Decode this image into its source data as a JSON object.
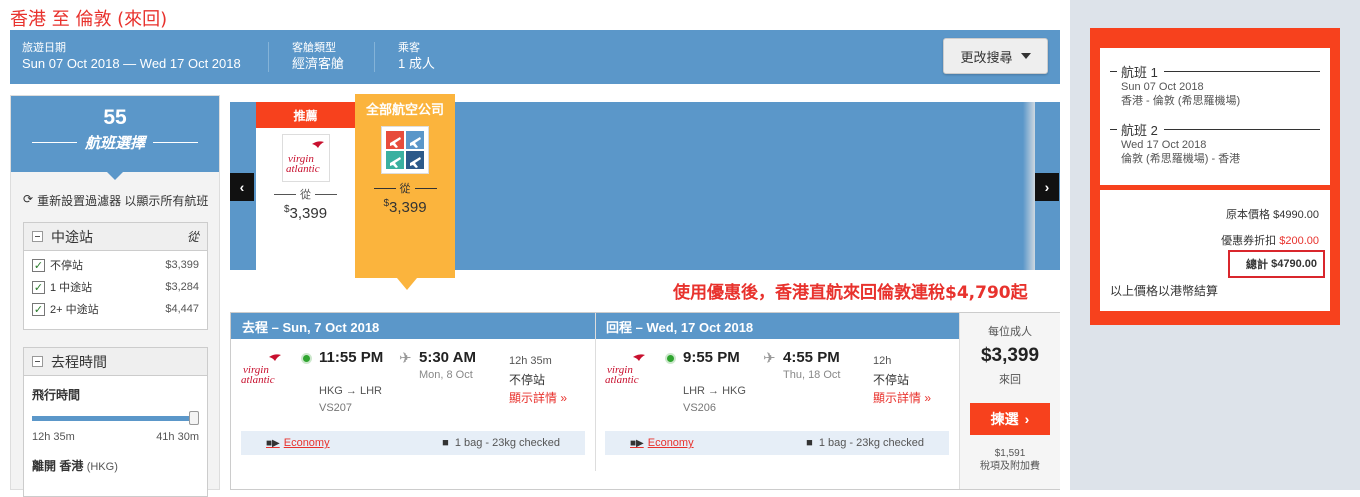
{
  "page_title": "香港 至 倫敦 (來回)",
  "search": {
    "dates_label": "旅遊日期",
    "dates_value": "Sun 07 Oct 2018 — Wed 17 Oct 2018",
    "cabin_label": "客艙類型",
    "cabin_value": "經濟客艙",
    "pax_label": "乘客",
    "pax_value": "1 成人",
    "change_button": "更改搜尋"
  },
  "filters": {
    "count": "55",
    "count_label": "航班選擇",
    "reset_label": "重新設置過濾器 以顯示所有航班",
    "stops_title": "中途站",
    "stops": [
      {
        "label": "不停站",
        "price": "$3,399"
      },
      {
        "label": "1 中途站",
        "price": "$3,284"
      },
      {
        "label": "2+ 中途站",
        "price": "$4,447"
      }
    ],
    "time_title": "去程時間",
    "flight_time_label": "飛行時間",
    "flight_time_min": "12h 35m",
    "flight_time_max": "41h 30m",
    "depart_label": "離開 香港",
    "depart_code": "(HKG)"
  },
  "carousel": {
    "recommended_banner": "推薦",
    "recommended_from": "從",
    "recommended_currency": "$",
    "recommended_price": "3,399",
    "all_banner": "全部航空公司",
    "all_from": "從",
    "all_currency": "$",
    "all_price": "3,399",
    "airline_logo_text1": "virgin",
    "airline_logo_text2": "atlantic"
  },
  "promo_text": "使用優惠後，香港直航來回倫敦連稅$4,790起",
  "result": {
    "outbound_title": "去程 – Sun, 7 Oct 2018",
    "return_title": "回程 – Wed, 17 Oct 2018",
    "outbound": {
      "dep": "11:55 PM",
      "arr": "5:30 AM",
      "arr_date": "Mon, 8 Oct",
      "route": "HKG → LHR",
      "flight_no": "VS207",
      "duration": "12h 35m",
      "stops": "不停站",
      "details": "顯示詳情",
      "cabin": "Economy",
      "bag": "1 bag - 23kg checked"
    },
    "inbound": {
      "dep": "9:55 PM",
      "arr": "4:55 PM",
      "arr_date": "Thu, 18 Oct",
      "route": "LHR → HKG",
      "flight_no": "VS206",
      "duration": "12h",
      "stops": "不停站",
      "details": "顯示詳情",
      "cabin": "Economy",
      "bag": "1 bag - 23kg checked"
    },
    "per_adult": "每位成人",
    "price": "$3,399",
    "round_trip": "來回",
    "select_button": "揀選",
    "tax_amount": "$1,591",
    "tax_label": "稅項及附加費"
  },
  "summary": {
    "flight1_label": "航班 1",
    "flight1_date": "Sun 07 Oct 2018",
    "flight1_route": "香港 - 倫敦 (希思羅機場)",
    "flight2_label": "航班 2",
    "flight2_date": "Wed 17 Oct 2018",
    "flight2_route": "倫敦 (希思羅機場) - 香港",
    "original_label": "原本價格",
    "original_value": "$4990.00",
    "discount_label": "優惠券折扣",
    "discount_value": "$200.00",
    "total_label": "總計",
    "total_value": "$4790.00",
    "currency_note": "以上價格以港幣結算"
  },
  "colors": {
    "accent": "#5b97c9",
    "orange": "#f7411d",
    "yellow": "#fbb43d",
    "red": "#e8322d"
  }
}
